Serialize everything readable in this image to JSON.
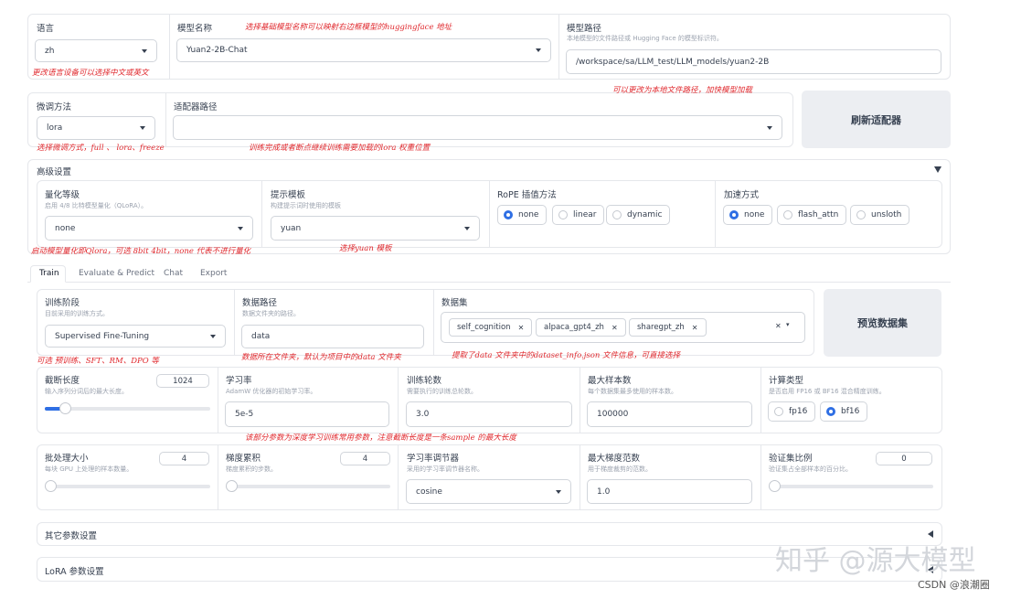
{
  "top": {
    "lang_label": "语言",
    "lang_value": "zh",
    "model_label": "模型名称",
    "model_value": "Yuan2-2B-Chat",
    "path_label": "模型路径",
    "path_sub": "本地模型的文件路径或 Hugging Face 的模型标识符。",
    "path_value": "/workspace/sa/LLM_test/LLM_models/yuan2-2B"
  },
  "finetune": {
    "method_label": "微调方法",
    "method_value": "lora",
    "adapter_label": "适配器路径",
    "refresh_button": "刷新适配器"
  },
  "advanced": {
    "title": "高级设置",
    "quant_label": "量化等级",
    "quant_sub": "启用 4/8 比特模型量化（QLoRA）。",
    "quant_value": "none",
    "template_label": "提示模板",
    "template_sub": "构建提示词时使用的模板",
    "template_value": "yuan",
    "rope_label": "RoPE 插值方法",
    "rope_options": [
      "none",
      "linear",
      "dynamic"
    ],
    "accel_label": "加速方式",
    "accel_options": [
      "none",
      "flash_attn",
      "unsloth"
    ]
  },
  "tabs": [
    "Train",
    "Evaluate & Predict",
    "Chat",
    "Export"
  ],
  "train": {
    "stage_label": "训练阶段",
    "stage_sub": "目前采用的训练方式。",
    "stage_value": "Supervised Fine-Tuning",
    "dir_label": "数据路径",
    "dir_sub": "数据文件夹的路径。",
    "dir_value": "data",
    "dataset_label": "数据集",
    "datasets": [
      "self_cognition",
      "alpaca_gpt4_zh",
      "sharegpt_zh"
    ],
    "preview_button": "预览数据集"
  },
  "params1": {
    "cutoff_label": "截断长度",
    "cutoff_sub": "输入序列分词后的最大长度。",
    "cutoff_value": "1024",
    "cutoff_fraction": 0.12,
    "lr_label": "学习率",
    "lr_sub": "AdamW 优化器的初始学习率。",
    "lr_value": "5e-5",
    "epochs_label": "训练轮数",
    "epochs_sub": "需要执行的训练总轮数。",
    "epochs_value": "3.0",
    "samples_label": "最大样本数",
    "samples_sub": "每个数据集最多使用的样本数。",
    "samples_value": "100000",
    "compute_label": "计算类型",
    "compute_sub": "是否启用 FP16 或 BF16 混合精度训练。",
    "compute_options": [
      "fp16",
      "bf16"
    ]
  },
  "params2": {
    "batch_label": "批处理大小",
    "batch_sub": "每块 GPU 上处理的样本数量。",
    "batch_value": "4",
    "accum_label": "梯度累积",
    "accum_sub": "梯度累积的步数。",
    "accum_value": "4",
    "sched_label": "学习率调节器",
    "sched_sub": "采用的学习率调节器名称。",
    "sched_value": "cosine",
    "grad_label": "最大梯度范数",
    "grad_sub": "用于梯度裁剪的范数。",
    "grad_value": "1.0",
    "val_label": "验证集比例",
    "val_sub": "验证集占全部样本的百分比。",
    "val_value": "0"
  },
  "sections": {
    "other": "其它参数设置",
    "lora": "LoRA 参数设置"
  },
  "annotations": {
    "a1": "选择基础模型名称可以映射右边框模型的huggingface 地址",
    "a2": "更改语言设备可以选择中文或英文",
    "a3": "可以更改为本地文件路径，加快模型加载",
    "a4": "选择微调方式，full 、 lora、freeze",
    "a5": "训练完成或者断点继续训练需要加载的lora 权重位置",
    "a6": "启动模型量化即Qlora，可选 8bit 4bit，none 代表不进行量化",
    "a7": "选择yuan 模板",
    "a8": "可选 预训练、SFT、RM、DPO 等",
    "a9": "数据所在文件夹，默认为项目中的data 文件夹",
    "a10": "提取了data 文件夹中的dataset_info.json 文件信息，可直接选择",
    "a11": "该部分参数为深度学习训练常用参数，注意截断长度是一条sample 的最大长度"
  },
  "watermark": {
    "main": "知乎 @源大模型",
    "sub": "CSDN @浪潮圈"
  }
}
